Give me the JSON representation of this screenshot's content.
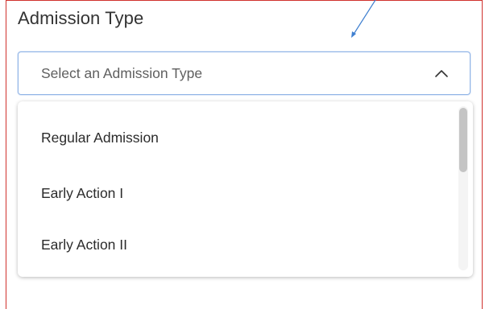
{
  "field": {
    "label": "Admission Type"
  },
  "select": {
    "placeholder": "Select an Admission Type",
    "state": "open",
    "border_color": "#8fb3e6"
  },
  "dropdown": {
    "options": [
      {
        "label": "Regular Admission"
      },
      {
        "label": "Early Action I"
      },
      {
        "label": "Early Action II"
      }
    ]
  },
  "icons": {
    "chevron": "chevron-up-icon",
    "arrow": "annotation-arrow-icon"
  },
  "colors": {
    "frame_border": "#d0312d",
    "annotation_arrow": "#3f7fd0"
  }
}
